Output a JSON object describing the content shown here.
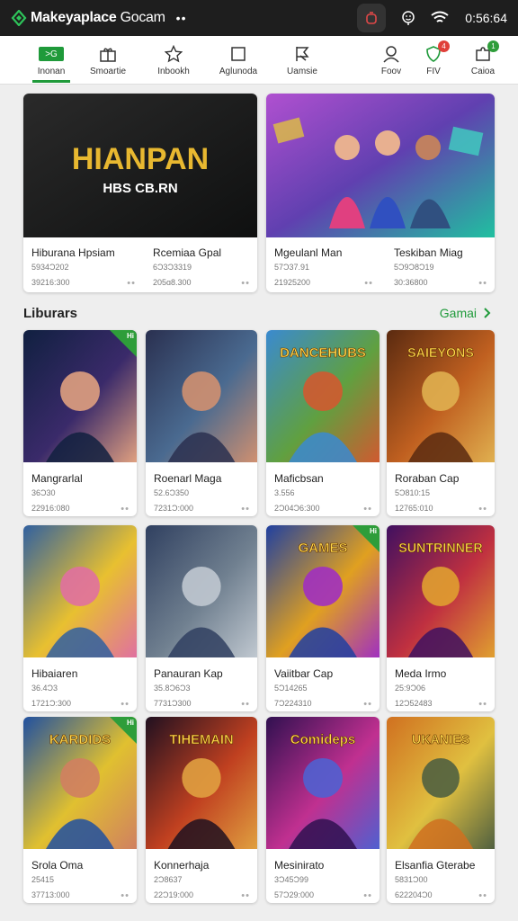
{
  "appbar": {
    "title": "Makeyaplace",
    "title_suffix": "Gocam",
    "menu_dots": "••",
    "time": "0:56:64",
    "icons": [
      "app-logo-icon",
      "camera-icon",
      "smiley-icon",
      "wifi-icon"
    ]
  },
  "tabs": [
    {
      "label": "Inonan",
      "icon_text": ">G",
      "active": true
    },
    {
      "label": "Smoartie",
      "icon": "gift-icon"
    },
    {
      "label": "Inbookh",
      "icon": "star-icon"
    },
    {
      "label": "Aglunoda",
      "icon": "square-icon"
    },
    {
      "label": "Uamsie",
      "icon": "flag-icon"
    },
    {
      "label": "Foov",
      "icon": "person-icon"
    },
    {
      "label": "FIV",
      "icon": "shield-icon",
      "badge": "4",
      "badge_color": "#e0403a"
    },
    {
      "label": "Caioa",
      "icon": "puzzle-icon",
      "badge": "1",
      "badge_color": "#2e9d3a"
    }
  ],
  "featured": [
    {
      "name": "Hiburana Hpsiam",
      "line2": "5934Ɔ202",
      "line3": "39216:300",
      "dots": "••",
      "banner_title": "HIANPAN",
      "banner_sub": "HBS CB.RN"
    },
    {
      "name": "Rcemiaa Gpal",
      "line2": "6Ɔ3Ɔ3319",
      "line3": "205ɑ8.300",
      "dots": "••"
    },
    {
      "name": "Mgeulanl Man",
      "line2": "57Ɔ37.91",
      "line3": "21925200",
      "dots": "••"
    },
    {
      "name": "Teskiban Miag",
      "line2": "5Ɔ9Ɔ8Ɔ19",
      "line3": "30:36800",
      "dots": "••"
    }
  ],
  "section": {
    "title": "Liburars",
    "link": "Gamai",
    "link_icon": "chevron-right-icon"
  },
  "grid": [
    {
      "name": "Mangrarlal",
      "line2": "36Ɔ30",
      "line3": "22916:080",
      "dots": "••",
      "corner": "Hi",
      "palette": [
        "#102040",
        "#3a2a6a",
        "#e0a080"
      ]
    },
    {
      "name": "Roenarl Maga",
      "line2": "52.6Ɔ350",
      "line3": "7231Ɔ:000",
      "dots": "••",
      "palette": [
        "#2a3050",
        "#4a6a90",
        "#d09070"
      ]
    },
    {
      "name": "Maficbsan",
      "line2": "3.556",
      "line3": "2Ɔ04Ɔ6:300",
      "dots": "••",
      "cover_text": "DANCEHUBS",
      "palette": [
        "#3a8ad0",
        "#60a040",
        "#d05a30"
      ]
    },
    {
      "name": "Roraban Cap",
      "line2": "5Ɔ810:15",
      "line3": "12765:010",
      "dots": "••",
      "cover_text": "SAIEYONS",
      "palette": [
        "#5a2a10",
        "#c06020",
        "#e0b050"
      ]
    },
    {
      "name": "Hibaiaren",
      "line2": "36.4Ɔ3",
      "line3": "1721Ɔ:300",
      "dots": "••",
      "palette": [
        "#3060a0",
        "#e8c030",
        "#e070a0"
      ]
    },
    {
      "name": "Panauran Kap",
      "line2": "35.8Ɔ6Ɔ3",
      "line3": "7731Ɔ300",
      "dots": "••",
      "palette": [
        "#304060",
        "#708090",
        "#c0c8d0"
      ]
    },
    {
      "name": "Vaiitbar Cap",
      "line2": "5Ɔ14265",
      "line3": "7Ɔ224310",
      "dots": "••",
      "cover_text": "GAMES",
      "corner": "Hi",
      "palette": [
        "#2040a0",
        "#e0a020",
        "#a030c0"
      ]
    },
    {
      "name": "Meda Irmo",
      "line2": "25:9Ɔ06",
      "line3": "12Ɔ52483",
      "dots": "••",
      "cover_text": "SUNTRINNER",
      "palette": [
        "#401060",
        "#c03040",
        "#e0a030"
      ]
    },
    {
      "name": "Srola Oma",
      "line2": "25415",
      "line3": "37713:000",
      "dots": "••",
      "cover_text": "KARDIDS",
      "corner": "Hi",
      "palette": [
        "#2050a0",
        "#e0c030",
        "#d08060"
      ]
    },
    {
      "name": "Konnerhaja",
      "line2": "2Ɔ8637",
      "line3": "22Ɔ19:000",
      "dots": "••",
      "cover_text": "TIHEMAIN",
      "palette": [
        "#201020",
        "#c04020",
        "#e0a040"
      ]
    },
    {
      "name": "Mesinirato",
      "line2": "3Ɔ45Ɔ99",
      "line3": "57Ɔ29:000",
      "dots": "••",
      "cover_text": "Comideps",
      "palette": [
        "#301050",
        "#c03090",
        "#5060d0"
      ]
    },
    {
      "name": "Elsanfia Gterabe",
      "line2": "5831Ɔ00",
      "line3": "622204Ɔ0",
      "dots": "••",
      "cover_text": "UKANIES",
      "palette": [
        "#d07020",
        "#e0c040",
        "#506040"
      ]
    }
  ]
}
